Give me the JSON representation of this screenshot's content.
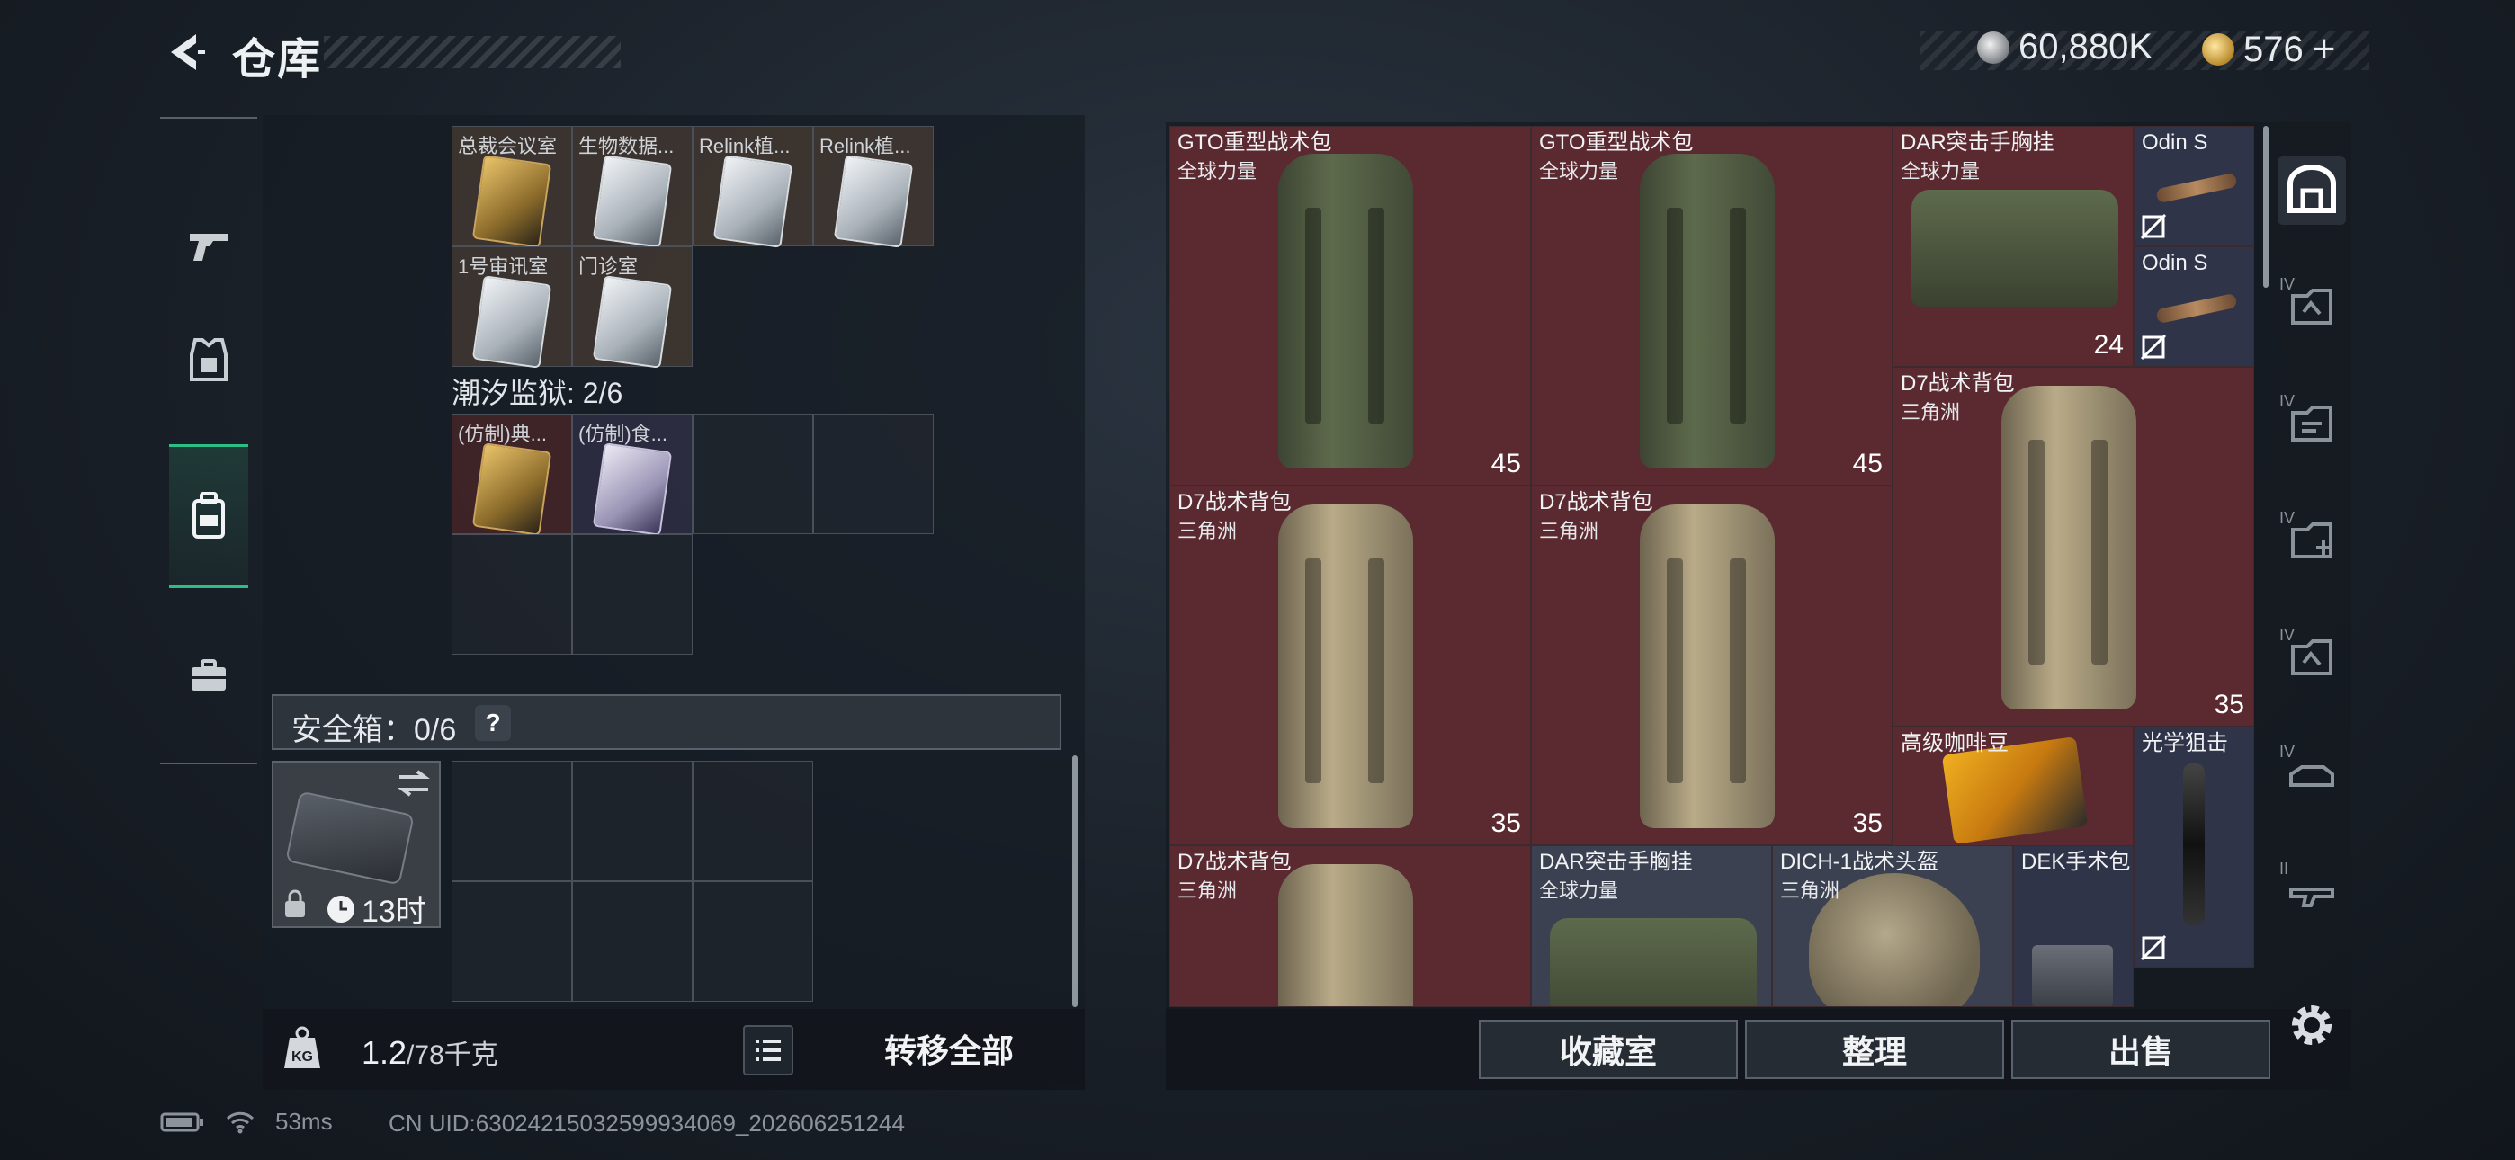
{
  "header": {
    "title": "仓库",
    "currency_silver": "60,880K",
    "currency_gold": "576",
    "add_symbol": "+"
  },
  "left_nav": [
    {
      "icon": "pistol-icon"
    },
    {
      "icon": "armor-icon"
    },
    {
      "icon": "backpack-icon",
      "active": true
    },
    {
      "icon": "toolbox-icon"
    }
  ],
  "cards_group_1": [
    {
      "label": "总裁会议室",
      "color": "gold"
    },
    {
      "label": "生物数据...",
      "color": "silver"
    },
    {
      "label": "Relink植...",
      "color": "silver"
    },
    {
      "label": "Relink植...",
      "color": "silver"
    },
    {
      "label": "1号审讯室",
      "color": "silver"
    },
    {
      "label": "门诊室",
      "color": "silver"
    }
  ],
  "group_title": "潮汐监狱: 2/6",
  "cards_group_2": [
    {
      "label": "(仿制)典...",
      "color": "gold"
    },
    {
      "label": "(仿制)食...",
      "color": "violet"
    }
  ],
  "safe": {
    "label": "安全箱：0/6",
    "help": "?",
    "timer": "13时"
  },
  "weight": {
    "current": "1.2",
    "max": "/78千克",
    "kg_label": "KG"
  },
  "transfer_all": "转移全部",
  "items": [
    {
      "name": "GTO重型战术包",
      "sub": "全球力量",
      "badge": "45"
    },
    {
      "name": "GTO重型战术包",
      "sub": "全球力量",
      "badge": "45"
    },
    {
      "name": "DAR突击手胸挂",
      "sub": "全球力量",
      "badge": "24"
    },
    {
      "name": "Odin S",
      "sub": ""
    },
    {
      "name": "Odin S",
      "sub": ""
    },
    {
      "name": "D7战术背包",
      "sub": "三角洲",
      "badge": "35"
    },
    {
      "name": "D7战术背包",
      "sub": "三角洲",
      "badge": "35"
    },
    {
      "name": "D7战术背包",
      "sub": "三角洲",
      "badge": "35"
    },
    {
      "name": "高级咖啡豆",
      "sub": ""
    },
    {
      "name": "光学狙击",
      "sub": ""
    },
    {
      "name": "D7战术背包",
      "sub": "三角洲"
    },
    {
      "name": "DAR突击手胸挂",
      "sub": "全球力量"
    },
    {
      "name": "DICH-1战术头盔",
      "sub": "三角洲"
    },
    {
      "name": "DEK手术包",
      "sub": ""
    }
  ],
  "right_nav_tiers": [
    "IV",
    "IV",
    "IV",
    "IV",
    "IV",
    "II"
  ],
  "actions": {
    "collection": "收藏室",
    "sort": "整理",
    "sell": "出售"
  },
  "status": {
    "ping": "53ms",
    "uid": "CN UID:630242150325999340​69_202606251244"
  }
}
